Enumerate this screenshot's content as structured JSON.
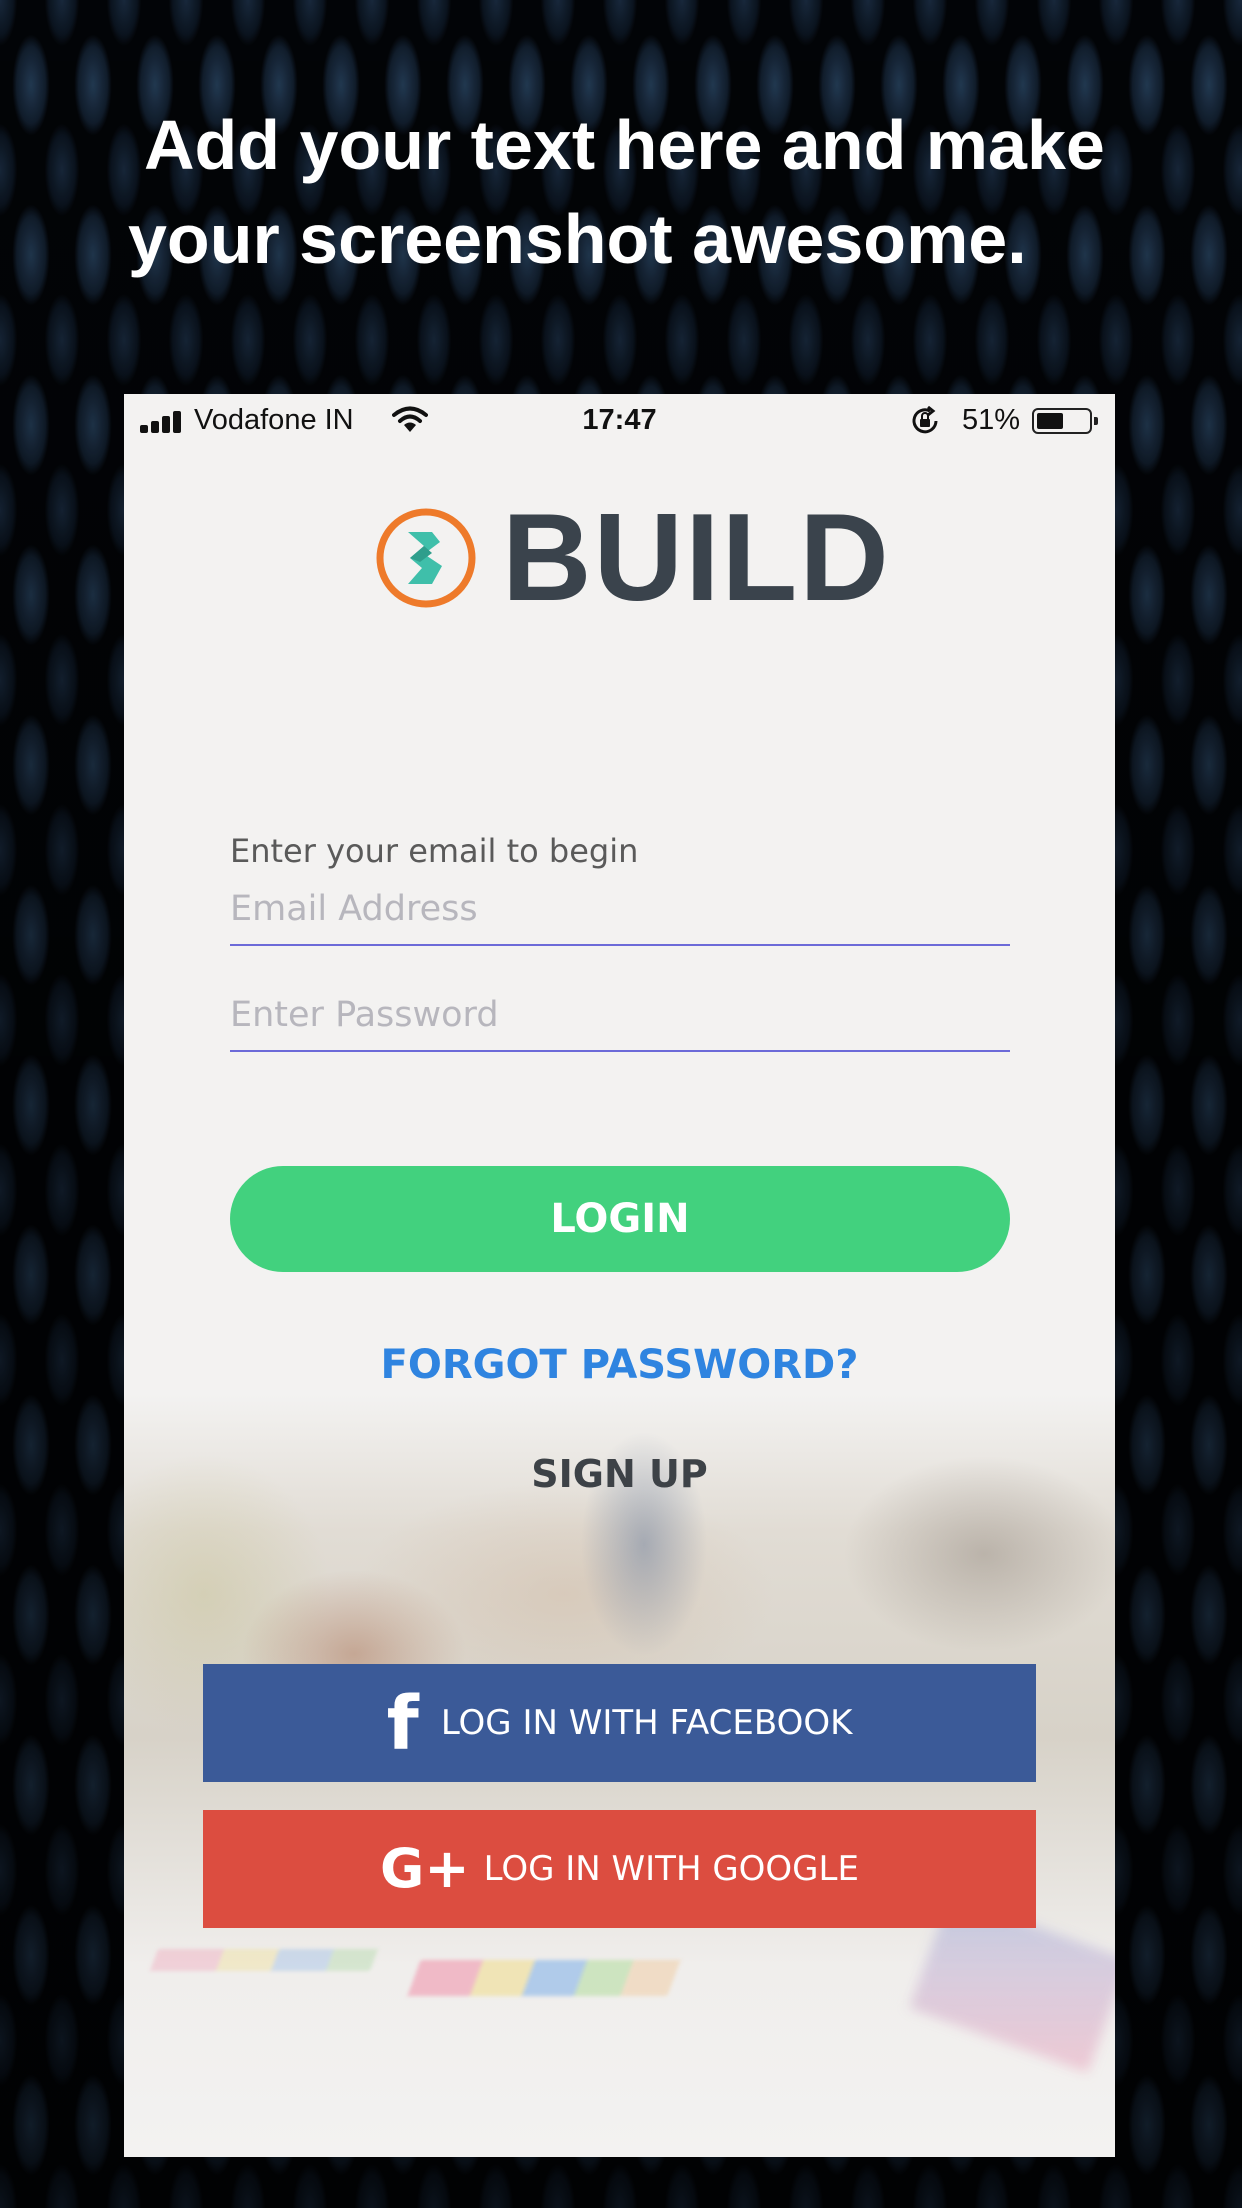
{
  "headline": {
    "line1": "Add your text here and make",
    "line2": "your screenshot awesome."
  },
  "status_bar": {
    "carrier": "Vodafone IN",
    "time": "17:47",
    "battery_percent": "51%",
    "battery_level": 0.51
  },
  "logo": {
    "text": "BUILD"
  },
  "form": {
    "prompt": "Enter your email to begin",
    "email_placeholder": "Email Address",
    "email_value": "",
    "password_placeholder": "Enter Password",
    "password_value": ""
  },
  "actions": {
    "login": "LOGIN",
    "forgot_password": "FORGOT PASSWORD?",
    "sign_up": "SIGN UP"
  },
  "social": {
    "facebook_label": "LOG IN WITH FACEBOOK",
    "facebook_icon": "f",
    "google_label": "LOG IN WITH GOOGLE",
    "google_icon": "G+"
  },
  "colors": {
    "login_button": "#42d17e",
    "forgot_link": "#2f84e0",
    "facebook": "#3b5a98",
    "google": "#dc4d40",
    "logo_ring": "#ee7a2a",
    "logo_mark": "#3fbfaa",
    "logo_text": "#3a434c"
  }
}
